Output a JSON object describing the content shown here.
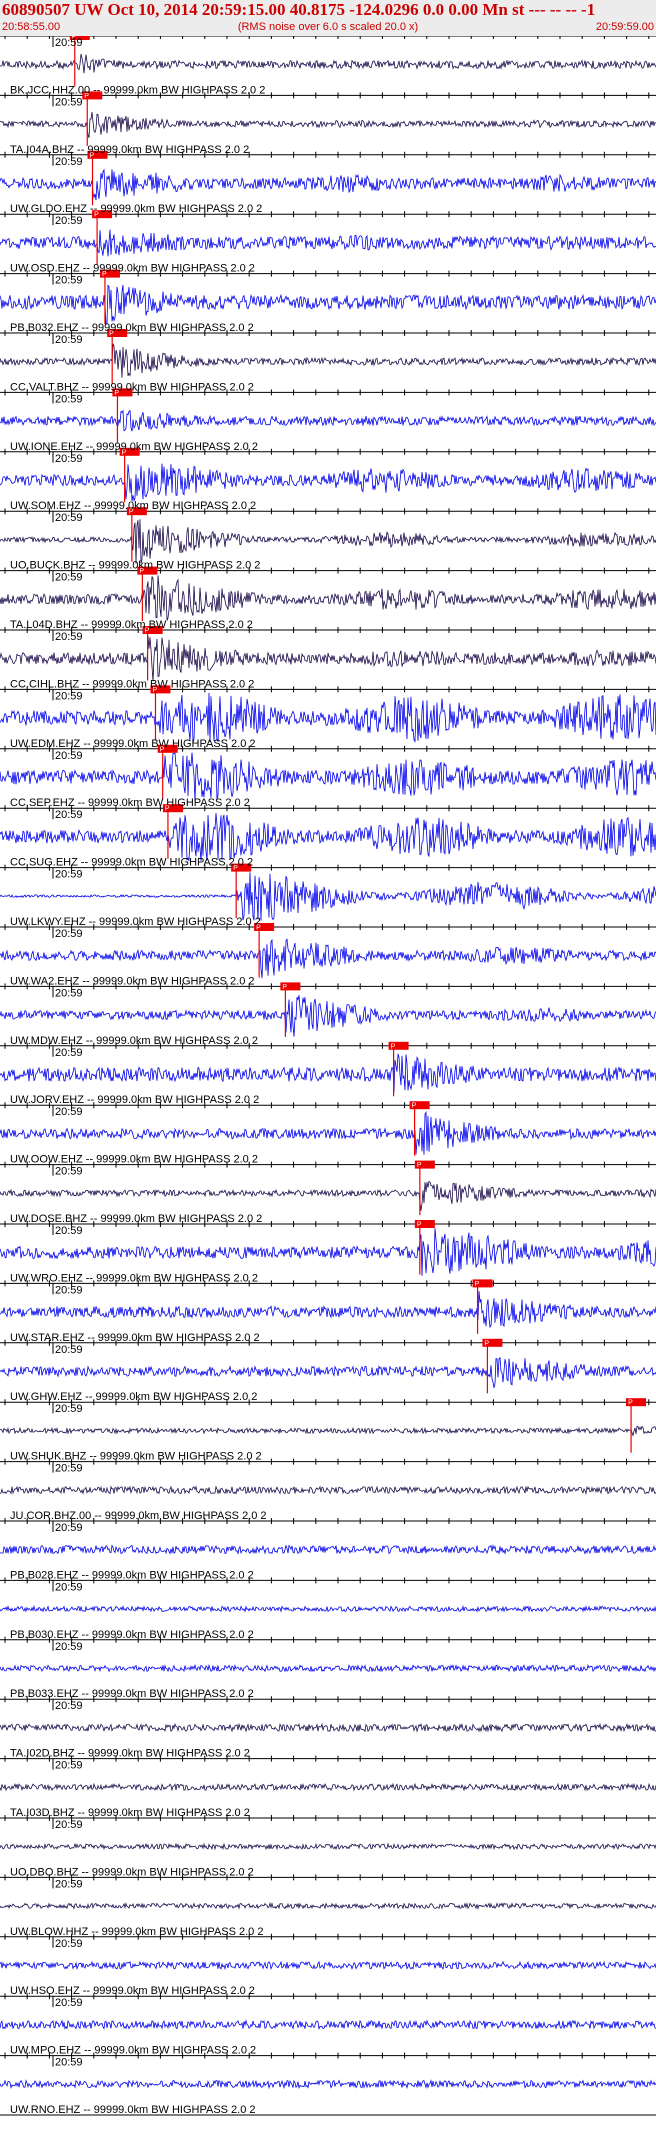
{
  "header": {
    "title": "60890507 UW Oct 10, 2014 20:59:15.00   40.8175 -124.0296  0.0 0.00 Mn st --- -- --  -1",
    "start_time": "20:58:55.00",
    "end_time": "20:59:59.00",
    "subtitle": "(RMS noise over 6.0 s scaled 20.0 x)"
  },
  "chart_data": {
    "type": "line",
    "minute_label": "20:59",
    "pick_label": "P",
    "colors": {
      "dark": "#1a0a4a",
      "blue": "#0000ee",
      "pick": "#ee0000",
      "grid": "#000000"
    },
    "traces": [
      {
        "label": "BK.JCC.HHZ.00 -- 99999.0km BW  HIGHPASS  2.0  2",
        "color": "dark",
        "amp": 0.16,
        "pick": 0.114,
        "event_amp": 0.55,
        "late": 0
      },
      {
        "label": "TA.I04A.BHZ -- 99999.0km BW  HIGHPASS  2.0  2",
        "color": "dark",
        "amp": 0.12,
        "pick": 0.133,
        "event_amp": 0.5,
        "late": 0.15
      },
      {
        "label": "UW.GLDO.EHZ -- 99999.0km BW  HIGHPASS  2.0  2",
        "color": "blue",
        "amp": 0.22,
        "pick": 0.141,
        "event_amp": 0.5,
        "late": 0.35
      },
      {
        "label": "UW.OSD.EHZ -- 99999.0km BW  HIGHPASS  2.0  2",
        "color": "blue",
        "amp": 0.25,
        "pick": 0.148,
        "event_amp": 0.45,
        "late": 0.3
      },
      {
        "label": "PB.B032.EHZ -- 99999.0km BW  HIGHPASS  2.0  2",
        "color": "blue",
        "amp": 0.28,
        "pick": 0.16,
        "event_amp": 0.75,
        "late": 0.3
      },
      {
        "label": "CC.VALT.BHZ -- 99999.0km BW  HIGHPASS  2.0  2",
        "color": "dark",
        "amp": 0.14,
        "pick": 0.171,
        "event_amp": 0.75,
        "late": 0.15
      },
      {
        "label": "UW.IONE.EHZ -- 99999.0km BW  HIGHPASS  2.0  2",
        "color": "blue",
        "amp": 0.18,
        "pick": 0.179,
        "event_amp": 0.4,
        "late": 0.2
      },
      {
        "label": "UW.SOM.EHZ -- 99999.0km BW  HIGHPASS  2.0  2",
        "color": "blue",
        "amp": 0.22,
        "pick": 0.19,
        "event_amp": 0.6,
        "late": 0.5
      },
      {
        "label": "UO.BUCK.BHZ -- 99999.0km BW  HIGHPASS  2.0  2",
        "color": "dark",
        "amp": 0.1,
        "pick": 0.201,
        "event_amp": 0.95,
        "late": 0.3
      },
      {
        "label": "TA.L04D.BHZ -- 99999.0km BW  HIGHPASS  2.0  2",
        "color": "dark",
        "amp": 0.2,
        "pick": 0.217,
        "event_amp": 0.95,
        "late": 0.45
      },
      {
        "label": "CC.CIHL.BHZ -- 99999.0km BW  HIGHPASS  2.0  2",
        "color": "dark",
        "amp": 0.24,
        "pick": 0.225,
        "event_amp": 0.85,
        "late": 0.35
      },
      {
        "label": "UW.EDM.EHZ -- 99999.0km BW  HIGHPASS  2.0  2",
        "color": "blue",
        "amp": 0.3,
        "pick": 0.237,
        "event_amp": 0.9,
        "late": 0.95
      },
      {
        "label": "CC.SEP.EHZ -- 99999.0km BW  HIGHPASS  2.0  2",
        "color": "blue",
        "amp": 0.28,
        "pick": 0.248,
        "event_amp": 0.7,
        "late": 0.75
      },
      {
        "label": "CC.SUG.EHZ -- 99999.0km BW  HIGHPASS  2.0  2",
        "color": "blue",
        "amp": 0.26,
        "pick": 0.256,
        "event_amp": 0.7,
        "late": 0.8
      },
      {
        "label": "UW.LKWY.EHZ -- 99999.0km BW  HIGHPASS  2.0  2",
        "color": "blue",
        "amp": 0.05,
        "pick": 0.36,
        "event_amp": 1.0,
        "late": 0.6
      },
      {
        "label": "UW.WA2.EHZ -- 99999.0km BW  HIGHPASS  2.0  2",
        "color": "blue",
        "amp": 0.2,
        "pick": 0.395,
        "event_amp": 0.8,
        "late": 0.35
      },
      {
        "label": "UW.MDW.EHZ -- 99999.0km BW  HIGHPASS  2.0  2",
        "color": "blue",
        "amp": 0.18,
        "pick": 0.435,
        "event_amp": 0.9,
        "late": 0.3
      },
      {
        "label": "UW.JORV.EHZ -- 99999.0km BW  HIGHPASS  2.0  2",
        "color": "blue",
        "amp": 0.28,
        "pick": 0.6,
        "event_amp": 0.85,
        "late": 0.3
      },
      {
        "label": "UW.OOW.EHZ -- 99999.0km BW  HIGHPASS  2.0  2",
        "color": "blue",
        "amp": 0.2,
        "pick": 0.632,
        "event_amp": 1.0,
        "late": 0.2
      },
      {
        "label": "UW.DOSE.BHZ -- 99999.0km BW  HIGHPASS  2.0  2",
        "color": "dark",
        "amp": 0.12,
        "pick": 0.64,
        "event_amp": 0.6,
        "late": 0.2
      },
      {
        "label": "UW.WRO.EHZ -- 99999.0km BW  HIGHPASS  2.0  2",
        "color": "blue",
        "amp": 0.24,
        "pick": 0.64,
        "event_amp": 0.85,
        "late": 0.6
      },
      {
        "label": "UW.STAR.EHZ -- 99999.0km BW  HIGHPASS  2.0  2",
        "color": "blue",
        "amp": 0.22,
        "pick": 0.728,
        "event_amp": 0.7,
        "late": 0.3
      },
      {
        "label": "UW.GHW.EHZ -- 99999.0km BW  HIGHPASS  2.0  2",
        "color": "blue",
        "amp": 0.2,
        "pick": 0.743,
        "event_amp": 0.55,
        "late": 0.35
      },
      {
        "label": "UW.SHUK.BHZ -- 99999.0km BW  HIGHPASS  2.0  2",
        "color": "dark",
        "amp": 0.1,
        "pick": 0.962,
        "event_amp": 0.15,
        "late": 0.1
      },
      {
        "label": "JU.COR.BHZ.00 -- 99999.0km BW  HIGHPASS  2.0  2",
        "color": "dark",
        "amp": 0.14,
        "pick": null,
        "event_amp": 0,
        "late": 0
      },
      {
        "label": "PB.B028.EHZ -- 99999.0km BW  HIGHPASS  2.0  2",
        "color": "blue",
        "amp": 0.16,
        "pick": null,
        "event_amp": 0,
        "late": 0
      },
      {
        "label": "PB.B030.EHZ -- 99999.0km BW  HIGHPASS  2.0  2",
        "color": "blue",
        "amp": 0.1,
        "pick": null,
        "event_amp": 0,
        "late": 0
      },
      {
        "label": "PB.B033.EHZ -- 99999.0km BW  HIGHPASS  2.0  2",
        "color": "blue",
        "amp": 0.12,
        "pick": null,
        "event_amp": 0,
        "late": 0
      },
      {
        "label": "TA.I02D.BHZ -- 99999.0km BW  HIGHPASS  2.0  2",
        "color": "dark",
        "amp": 0.14,
        "pick": null,
        "event_amp": 0,
        "late": 0
      },
      {
        "label": "TA.I03D.BHZ -- 99999.0km BW  HIGHPASS  2.0  2",
        "color": "dark",
        "amp": 0.12,
        "pick": null,
        "event_amp": 0,
        "late": 0
      },
      {
        "label": "UO.DBO.BHZ -- 99999.0km BW  HIGHPASS  2.0  2",
        "color": "dark",
        "amp": 0.1,
        "pick": null,
        "event_amp": 0,
        "late": 0
      },
      {
        "label": "UW.BLOW.HHZ -- 99999.0km BW  HIGHPASS  2.0  2",
        "color": "dark",
        "amp": 0.1,
        "pick": null,
        "event_amp": 0,
        "late": 0
      },
      {
        "label": "UW.HSO.EHZ -- 99999.0km BW  HIGHPASS  2.0  2",
        "color": "blue",
        "amp": 0.14,
        "pick": null,
        "event_amp": 0,
        "late": 0
      },
      {
        "label": "UW.MPO.EHZ -- 99999.0km BW  HIGHPASS  2.0  2",
        "color": "blue",
        "amp": 0.16,
        "pick": null,
        "event_amp": 0,
        "late": 0
      },
      {
        "label": "UW.RNO.EHZ -- 99999.0km BW  HIGHPASS  2.0  2",
        "color": "blue",
        "amp": 0.14,
        "pick": null,
        "event_amp": 0,
        "late": 0
      }
    ]
  }
}
